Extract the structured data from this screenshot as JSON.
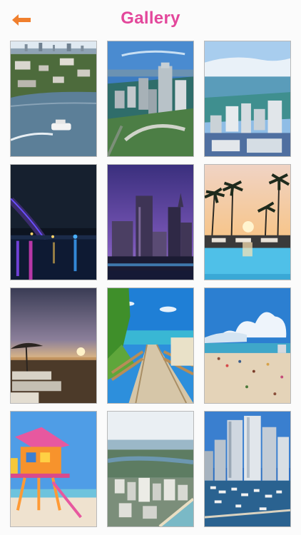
{
  "header": {
    "title": "Gallery",
    "back_icon": "back-arrow-icon"
  },
  "colors": {
    "accent": "#e3479b",
    "back_arrow": "#f07f2d",
    "background": "#fbfbfb"
  },
  "gallery": {
    "items": [
      {
        "image": "miami-bay-aerial-with-boat"
      },
      {
        "image": "miami-skyline-aerial-day"
      },
      {
        "image": "miami-beach-hotels-aerial"
      },
      {
        "image": "bridge-at-night-purple-lights"
      },
      {
        "image": "downtown-skyline-at-dusk"
      },
      {
        "image": "resort-pool-with-palms-at-sunset"
      },
      {
        "image": "beach-chairs-umbrella-at-sunset"
      },
      {
        "image": "wooden-beach-walkway"
      },
      {
        "image": "crowded-beach-with-clouds"
      },
      {
        "image": "lifeguard-tower-orange-pink"
      },
      {
        "image": "coastal-city-aerial"
      },
      {
        "image": "marina-with-high-rise-towers"
      }
    ]
  }
}
